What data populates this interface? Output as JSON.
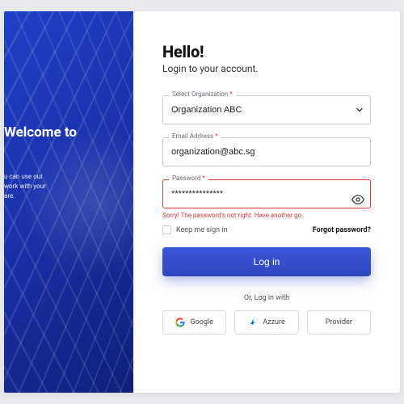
{
  "left": {
    "title_line1": "Welcome to",
    "title_line2": "",
    "desc_line1": "u can use our",
    "desc_line2": "work with your",
    "desc_line3": "are."
  },
  "form": {
    "heading": "Hello!",
    "subheading": "Login to your account.",
    "org": {
      "label": "Select Organization",
      "value": "Organization ABC"
    },
    "email": {
      "label": "Email Address",
      "value": "organization@abc.sg"
    },
    "password": {
      "label": "Password",
      "value": "***************",
      "error": "Sorry! The password's not right. Have another go."
    },
    "keep_label": "Keep me sign in",
    "forgot": "Forgot password?",
    "login": "Log in",
    "or": "Or, Log in with",
    "providers": {
      "google": "Google",
      "azure": "Azzure",
      "other": "Provider"
    }
  }
}
